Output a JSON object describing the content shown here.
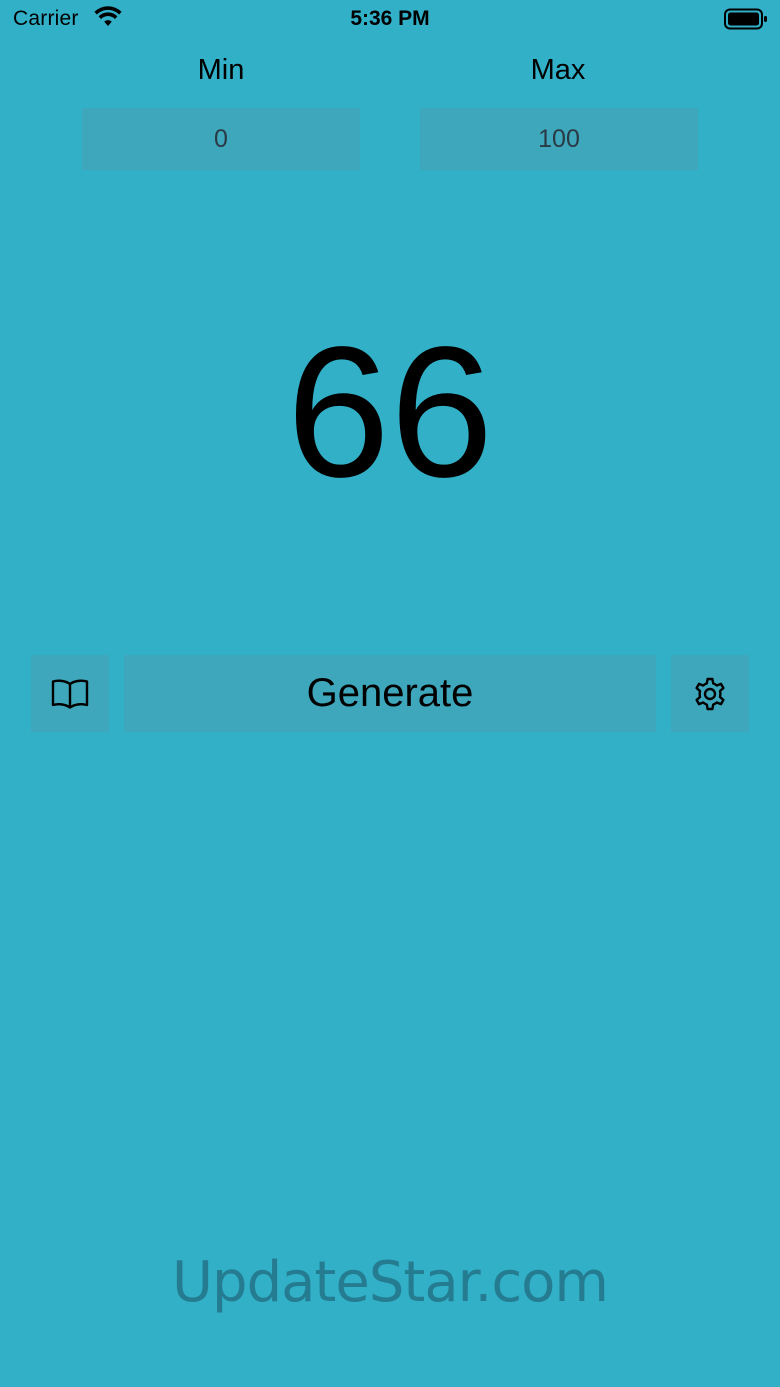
{
  "colors": {
    "background": "#31b0c8",
    "field_background": "#3ea7bc",
    "watermark_text": "#257c90"
  },
  "status_bar": {
    "carrier": "Carrier",
    "time": "5:36 PM",
    "wifi_icon": "wifi-icon",
    "battery_icon": "battery-full-icon"
  },
  "range": {
    "min_label": "Min",
    "min_value": "0",
    "max_label": "Max",
    "max_value": "100"
  },
  "result": {
    "value": "66"
  },
  "actions": {
    "book_icon": "book-icon",
    "generate_label": "Generate",
    "settings_icon": "gear-icon"
  },
  "watermark": {
    "text": "UpdateStar.com"
  }
}
